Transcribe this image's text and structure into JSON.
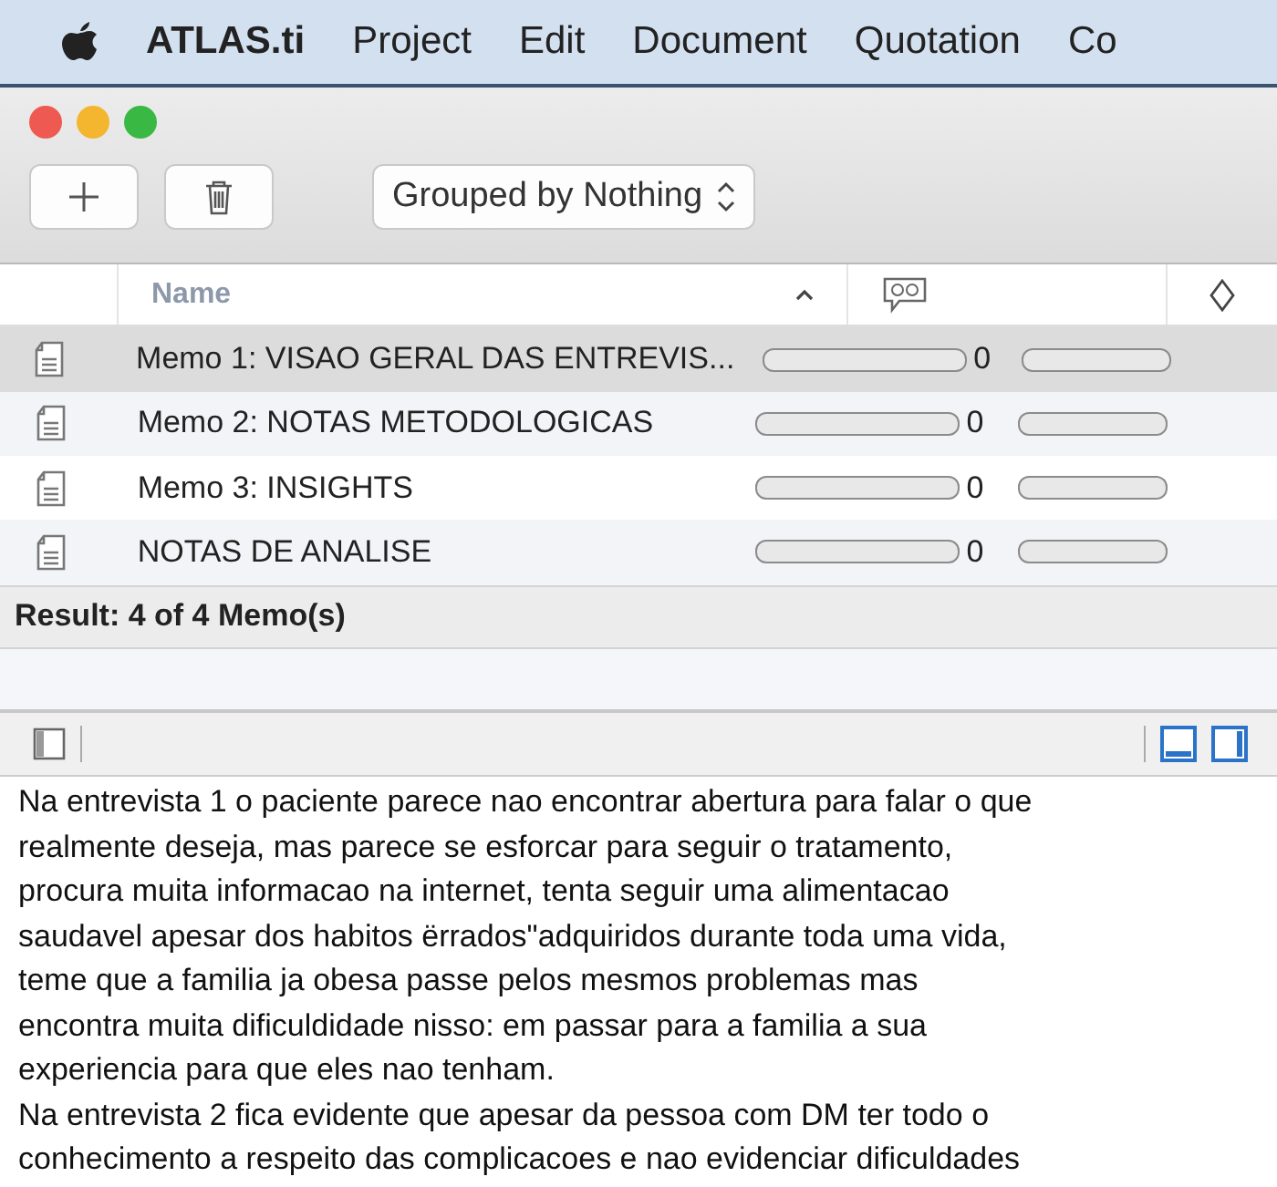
{
  "menu_bar": {
    "app_name": "ATLAS.ti",
    "items": [
      "Project",
      "Edit",
      "Document",
      "Quotation",
      "Co"
    ]
  },
  "toolbar": {
    "group_selector": "Grouped by Nothing"
  },
  "table": {
    "columns": [
      {
        "label": "Name",
        "sorted": true
      }
    ],
    "rows": [
      {
        "name": "Memo 1: VISAO GERAL DAS ENTREVIS...",
        "selected": true,
        "count": "0"
      },
      {
        "name": "Memo 2: NOTAS METODOLOGICAS",
        "selected": false,
        "count": "0"
      },
      {
        "name": "Memo 3: INSIGHTS",
        "selected": false,
        "count": "0"
      },
      {
        "name": "NOTAS DE ANALISE",
        "selected": false,
        "count": "0"
      }
    ],
    "result": "Result: 4 of 4 Memo(s)"
  },
  "editor": {
    "paragraphs": [
      [
        "Na entrevista 1 o paciente parece nao encontrar abertura para falar o que",
        "realmente deseja, mas parece se esforcar para seguir o tratamento,",
        "procura muita informacao na internet, tenta seguir uma alimentacao",
        "saudavel apesar dos habitos ërrados\"adquiridos durante toda uma vida,",
        "teme que a familia ja obesa passe pelos mesmos problemas mas",
        "encontra muita dificuldidade nisso: em passar para a familia a sua",
        "experiencia para que eles nao tenham."
      ],
      [
        "Na entrevista 2 fica evidente que apesar da pessoa com DM ter todo o",
        "conhecimento a respeito das complicacoes e nao evidenciar dificuldades"
      ]
    ]
  }
}
